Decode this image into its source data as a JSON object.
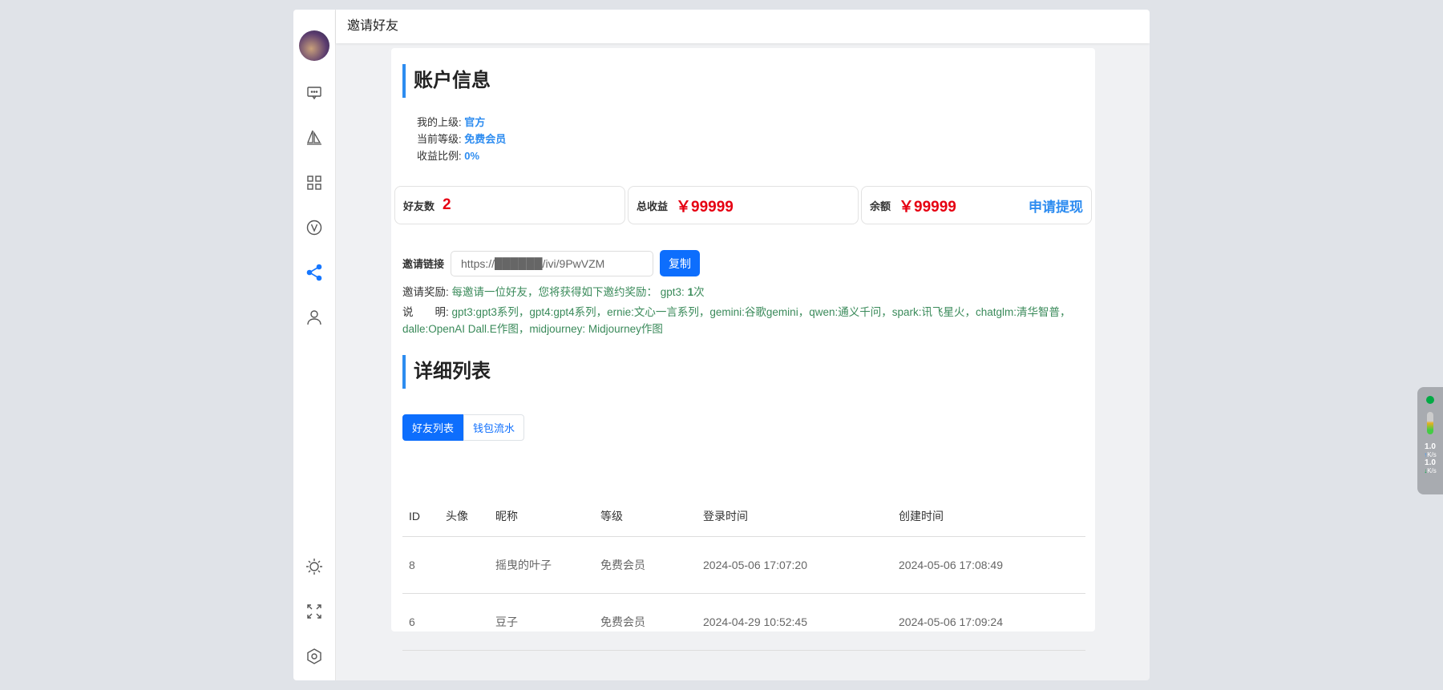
{
  "header": {
    "title": "邀请好友"
  },
  "account": {
    "title": "账户信息",
    "rows": [
      {
        "label": "我的上级:",
        "value": "官方"
      },
      {
        "label": "当前等级:",
        "value": "免费会员"
      },
      {
        "label": "收益比例:",
        "value": "0%"
      }
    ]
  },
  "stats": [
    {
      "label": "好友数",
      "value": "2"
    },
    {
      "label": "总收益",
      "value": "￥99999"
    },
    {
      "label": "余额",
      "value": "￥99999",
      "action": "申请提现"
    }
  ],
  "invite": {
    "label": "邀请链接",
    "url": "https://██████/ivi/9PwVZM",
    "copy": "复制",
    "reward_label": "邀请奖励:",
    "reward_text": "每邀请一位好友，您将获得如下邀约奖励： gpt3: ",
    "reward_count": "1",
    "reward_unit": "次",
    "note_label": "说　　明:",
    "note_text": "gpt3:gpt3系列，gpt4:gpt4系列，ernie:文心一言系列，gemini:谷歌gemini，qwen:通义千问，spark:讯飞星火，chatglm:清华智普，dalle:OpenAI Dall.E作图，midjourney: Midjourney作图"
  },
  "detail": {
    "title": "详细列表",
    "tabs": [
      "好友列表",
      "钱包流水"
    ],
    "columns": [
      "ID",
      "头像",
      "昵称",
      "等级",
      "登录时间",
      "创建时间"
    ],
    "rows": [
      [
        "8",
        "",
        "摇曳的叶子",
        "免费会员",
        "2024-05-06 17:07:20",
        "2024-05-06 17:08:49"
      ],
      [
        "6",
        "",
        "豆子",
        "免费会员",
        "2024-04-29 10:52:45",
        "2024-05-06 17:09:24"
      ]
    ]
  },
  "widget": {
    "up": "1.0",
    "up_unit": "K/s",
    "down": "1.0",
    "down_unit": "K/s"
  }
}
